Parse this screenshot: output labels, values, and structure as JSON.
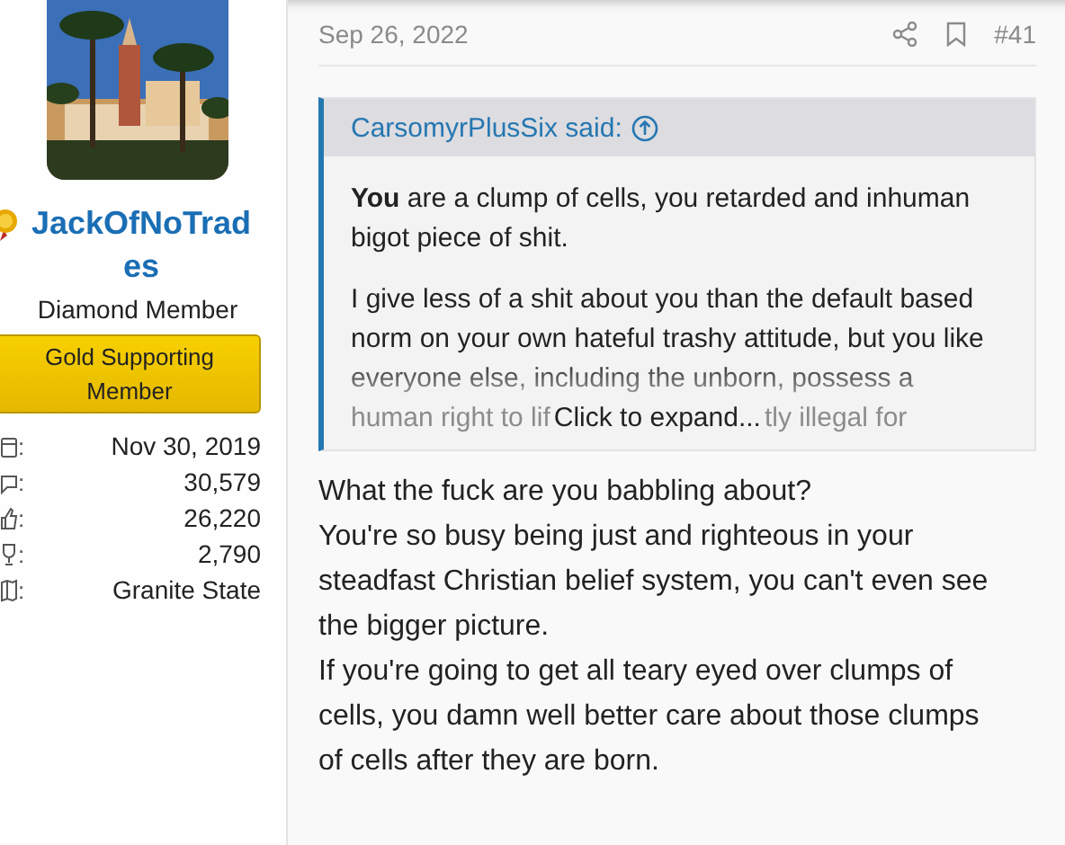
{
  "user": {
    "name": "JackOfNoTrades",
    "title": "Diamond Member",
    "banner": "Gold Supporting Member",
    "stats": [
      {
        "kind": "joined",
        "sep": ":",
        "value": "Nov 30, 2019"
      },
      {
        "kind": "messages",
        "sep": ":",
        "value": "30,579"
      },
      {
        "kind": "reactions",
        "sep": ":",
        "value": "26,220"
      },
      {
        "kind": "points",
        "sep": ":",
        "value": "2,790"
      },
      {
        "kind": "location",
        "sep": ":",
        "value": "Granite State"
      }
    ]
  },
  "post": {
    "date": "Sep 26, 2022",
    "number": "#41",
    "quote": {
      "author": "CarsomyrPlusSix said:",
      "paragraphs": [
        "**You** are a clump of cells, you retarded and inhuman bigot piece of shit.",
        "I give less of a shit about you than the default based norm on your own hateful trashy attitude, but you like everyone else, including the unborn, possess a"
      ],
      "faded_start": "human right to lif",
      "faded_end": "tly illegal for",
      "expand": "Click to expand..."
    },
    "body": [
      "What the fuck are you babbling about?",
      "You're so busy being just and righteous in your steadfast Christian belief system, you can't even see the bigger picture.",
      "If you're going to get all teary eyed over clumps of cells, you damn well better care about those clumps of cells after they are born."
    ]
  }
}
